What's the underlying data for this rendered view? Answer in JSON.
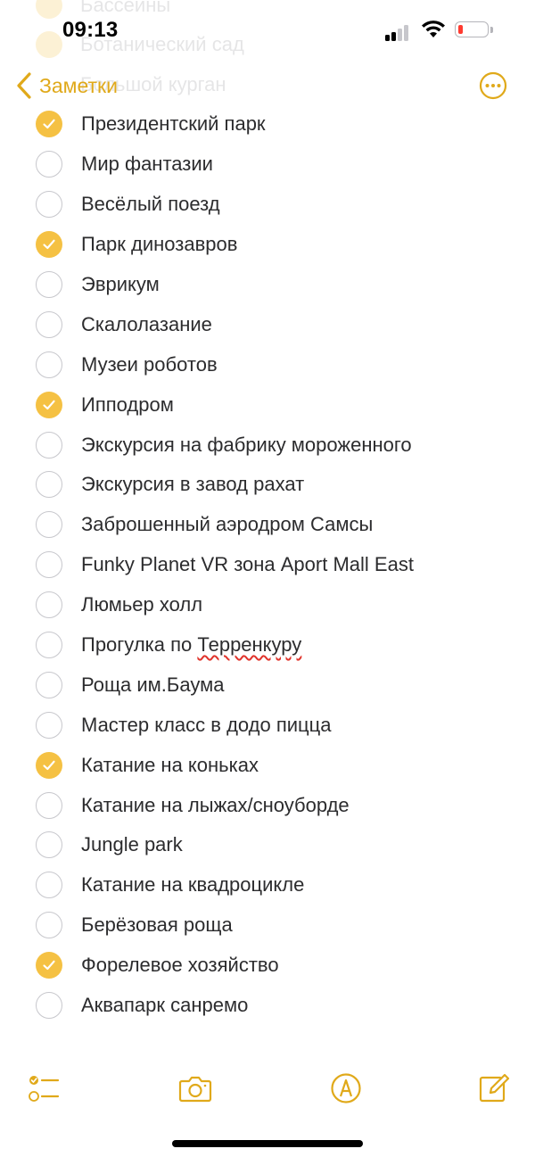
{
  "status_bar": {
    "time": "09:13",
    "battery_level": "low",
    "icons": [
      "cellular-signal-icon",
      "wifi-icon",
      "battery-icon"
    ]
  },
  "nav": {
    "back_label": "Заметки",
    "more_icon": "ellipsis-circle-icon"
  },
  "colors": {
    "accent": "#e0a91a",
    "checked_fill": "#f5c143",
    "unchecked_border": "#c7c7cc",
    "text": "#2c2c2e"
  },
  "ghost_items": [
    "Бассейны",
    "Ботанический сад",
    "Большой курган"
  ],
  "items": [
    {
      "label": "Президентский парк",
      "checked": true
    },
    {
      "label": "Мир фантазии",
      "checked": false
    },
    {
      "label": "Весёлый поезд",
      "checked": false
    },
    {
      "label": "Парк динозавров",
      "checked": true
    },
    {
      "label": "Эврикум",
      "checked": false
    },
    {
      "label": "Скалолазание",
      "checked": false
    },
    {
      "label": "Музеи роботов",
      "checked": false
    },
    {
      "label": "Ипподром",
      "checked": true
    },
    {
      "label": "Экскурсия на фабрику мороженного",
      "checked": false
    },
    {
      "label": "Экскурсия в завод рахат",
      "checked": false
    },
    {
      "label": "Заброшенный аэродром Самсы",
      "checked": false
    },
    {
      "label": "Funky Planet VR зона Aport Mall East",
      "checked": false
    },
    {
      "label": "Люмьер холл",
      "checked": false
    },
    {
      "label": "Прогулка по Терренкуру",
      "checked": false
    },
    {
      "label": "Роща им.Баума",
      "checked": false
    },
    {
      "label": "Мастер класс в додо пицца",
      "checked": false
    },
    {
      "label": "Катание на коньках",
      "checked": true
    },
    {
      "label": "Катание на лыжах/сноуборде",
      "checked": false
    },
    {
      "label": "Jungle park",
      "checked": false
    },
    {
      "label": "Катание на квадроцикле",
      "checked": false
    },
    {
      "label": "Берёзовая роща",
      "checked": false
    },
    {
      "label": "Форелевое хозяйство",
      "checked": true
    },
    {
      "label": "Аквапарк санремо",
      "checked": false
    }
  ],
  "toolbar": {
    "icons": [
      "checklist-icon",
      "camera-icon",
      "markup-pen-icon",
      "compose-icon"
    ]
  }
}
